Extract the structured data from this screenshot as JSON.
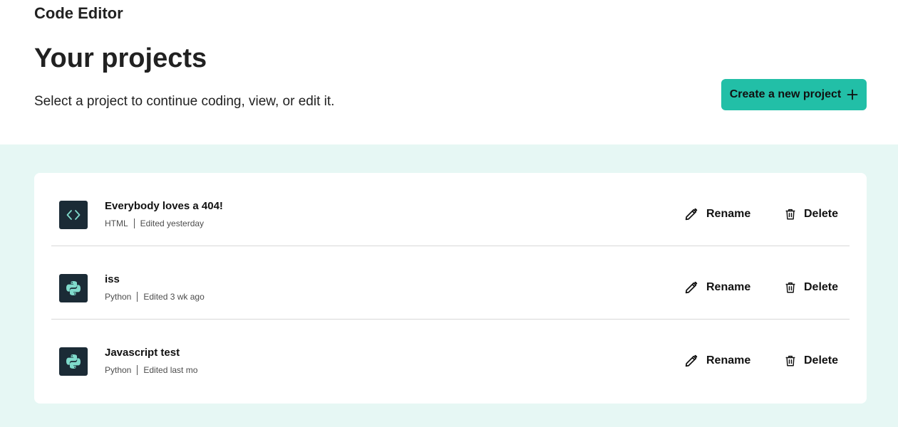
{
  "app": {
    "title": "Code Editor"
  },
  "page": {
    "title": "Your projects",
    "subtitle": "Select a project to continue coding, view, or edit it."
  },
  "create_button": {
    "label": "Create a new project",
    "icon": "plus-icon"
  },
  "projects": [
    {
      "name": "Everybody loves a 404!",
      "type": "HTML",
      "edited": "Edited yesterday",
      "icon": "html-code-icon"
    },
    {
      "name": "iss",
      "type": "Python",
      "edited": "Edited 3 wk ago",
      "icon": "python-icon"
    },
    {
      "name": "Javascript test",
      "type": "Python",
      "edited": "Edited last mo",
      "icon": "python-icon"
    }
  ],
  "actions": {
    "rename_label": "Rename",
    "delete_label": "Delete"
  },
  "colors": {
    "accent": "#22bfa7",
    "list_background": "#e6f7f4",
    "icon_tile": "#1b2b36",
    "icon_glyph": "#7fdacb"
  }
}
